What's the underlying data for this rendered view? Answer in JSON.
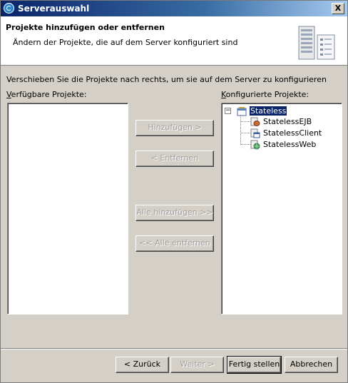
{
  "window": {
    "title": "Serverauswahl",
    "close_label": "X"
  },
  "header": {
    "title": "Projekte hinzufügen oder entfernen",
    "description": "Ändern der Projekte, die auf dem Server konfiguriert sind"
  },
  "instruction": "Verschieben Sie die Projekte nach rechts, um sie auf dem Server zu konfigurieren",
  "available": {
    "label_prefix": "",
    "label_mnemonic": "V",
    "label_rest": "erfügbare Projekte:",
    "items": []
  },
  "configured": {
    "label_mnemonic": "K",
    "label_rest": "onfigurierte Projekte:",
    "tree": {
      "root": "Stateless",
      "children": [
        "StatelessEJB",
        "StatelessClient",
        "StatelessWeb"
      ]
    }
  },
  "buttons": {
    "add": "Hinzufügen >",
    "remove": "< Entfernen",
    "add_all": "Alle hinzufügen >>",
    "remove_all": "<< Alle entfernen",
    "back": "< Zurück",
    "next": "Weiter >",
    "finish": "Fertig stellen",
    "cancel": "Abbrechen"
  },
  "icons": {
    "title": "eclipse-server-icon",
    "header": "server-wizard-icon",
    "root": "ear-project-icon",
    "ejb": "ejb-project-icon",
    "client": "client-project-icon",
    "web": "web-project-icon"
  }
}
